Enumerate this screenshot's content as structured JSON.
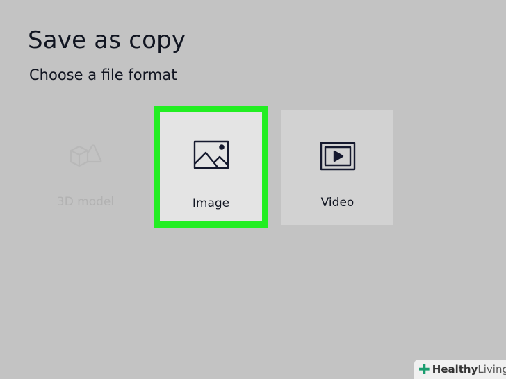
{
  "dialog": {
    "title": "Save as copy",
    "subtitle": "Choose a file format"
  },
  "options": [
    {
      "label": "3D model",
      "icon": "3d-model-icon",
      "state": "disabled"
    },
    {
      "label": "Image",
      "icon": "image-icon",
      "state": "selected"
    },
    {
      "label": "Video",
      "icon": "video-icon",
      "state": "normal"
    }
  ],
  "colors": {
    "background": "#c3c3c3",
    "highlight": "#22ee22",
    "text": "#111521",
    "disabled_text": "#b2b2b2"
  },
  "watermark": {
    "part1": "Healthy",
    "part2": "Living"
  }
}
